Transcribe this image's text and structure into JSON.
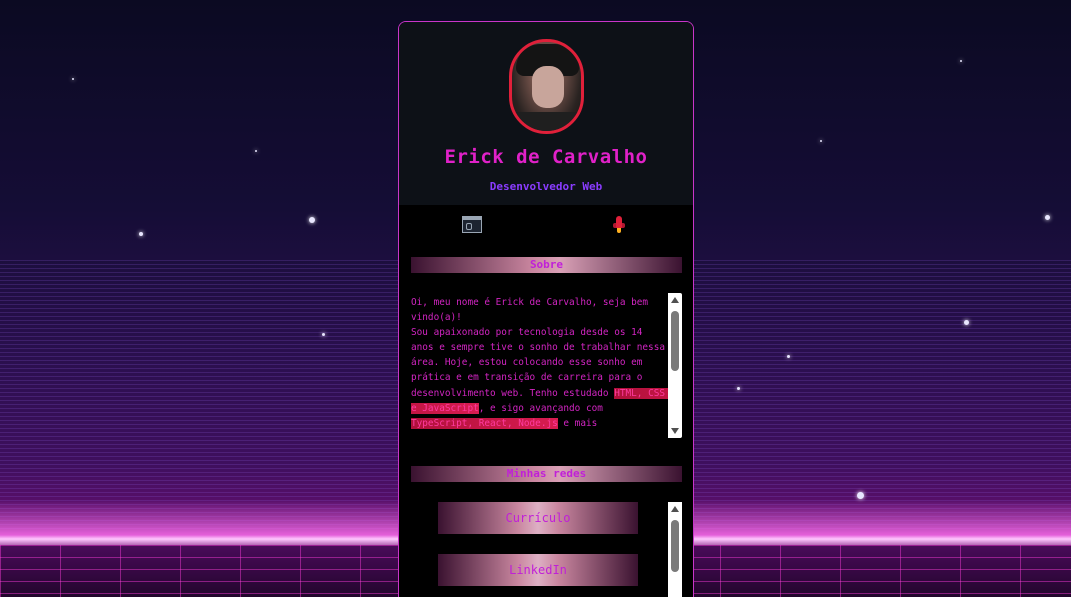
{
  "profile": {
    "name": "Erick de Carvalho",
    "role": "Desenvolvedor Web",
    "avatar_alt": "Erick de Carvalho"
  },
  "toolbar": {
    "terminal_icon": "terminal-icon",
    "rocket_icon": "rocket-icon"
  },
  "about": {
    "title": "Sobre",
    "text_1": "Oi, meu nome é Erick de Carvalho, seja bem vindo(a)!\nSou apaixonado por tecnologia desde os 14 anos e sempre tive o sonho de trabalhar nessa área. Hoje, estou colocando esse sonho em prática e em transição de carreira para o desenvolvimento web. Tenho estudado ",
    "highlight_1": "HTML, CSS e JavaScript",
    "text_2": ", e sigo avançando com ",
    "highlight_2": "TypeScript, React, Node.js",
    "text_3": " e mais"
  },
  "networks": {
    "title": "Minhas redes",
    "links": [
      {
        "label": "Currículo"
      },
      {
        "label": "LinkedIn"
      }
    ]
  },
  "colors": {
    "accent": "#e021c8",
    "role": "#8a3cff",
    "avatar_border": "#e0203a",
    "card_border": "#c935c9"
  }
}
